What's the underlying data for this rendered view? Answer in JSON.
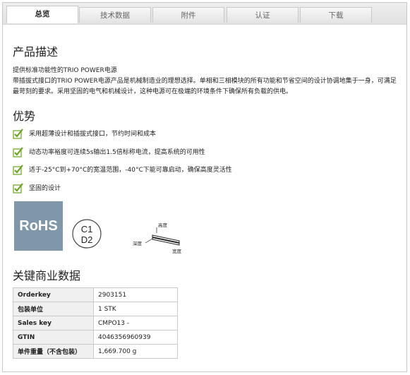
{
  "tabs": [
    {
      "label": "总览",
      "active": true
    },
    {
      "label": "技术数据",
      "active": false
    },
    {
      "label": "附件",
      "active": false
    },
    {
      "label": "认证",
      "active": false
    },
    {
      "label": "下载",
      "active": false
    }
  ],
  "description": {
    "heading": "产品描述",
    "line1": "提供标准功能性的TRIO POWER电源",
    "line2": "带插拔式接口的TRIO POWER电源产品是机械制造业的理想选择。单相和三相模块的所有功能和节省空间的设计协调地集于一身，可满足最苛刻的要求。采用坚固的电气和机械设计，这种电源可在极端的环境条件下确保所有负载的供电。"
  },
  "advantages": {
    "heading": "优势",
    "items": [
      "采用超薄设计和插拔式接口，节约时间和成本",
      "动态功率裕度可连续5s输出1.5倍标称电流，提高系统的可用性",
      "适于-25°C到+70°C的宽温范围，-40°C下能可靠启动，确保高度灵活性",
      "坚固的设计"
    ]
  },
  "badges": {
    "rohs": "RoHS",
    "class_top": "C1",
    "class_bottom": "D2",
    "dim_height": "高度",
    "dim_depth": "深度",
    "dim_width": "宽度"
  },
  "commercial": {
    "heading": "关键商业数据",
    "rows": [
      {
        "key": "Orderkey",
        "value": "2903151"
      },
      {
        "key": "包装单位",
        "value": "1 STK"
      },
      {
        "key": "Sales key",
        "value": "CMPO13 -"
      },
      {
        "key": "GTIN",
        "value": "4046356960939"
      },
      {
        "key": "单件重量（不含包装）",
        "value": "1,669.700 g"
      }
    ]
  },
  "colors": {
    "check_green": "#6aa323",
    "rohs_bg": "#7f97a8"
  }
}
